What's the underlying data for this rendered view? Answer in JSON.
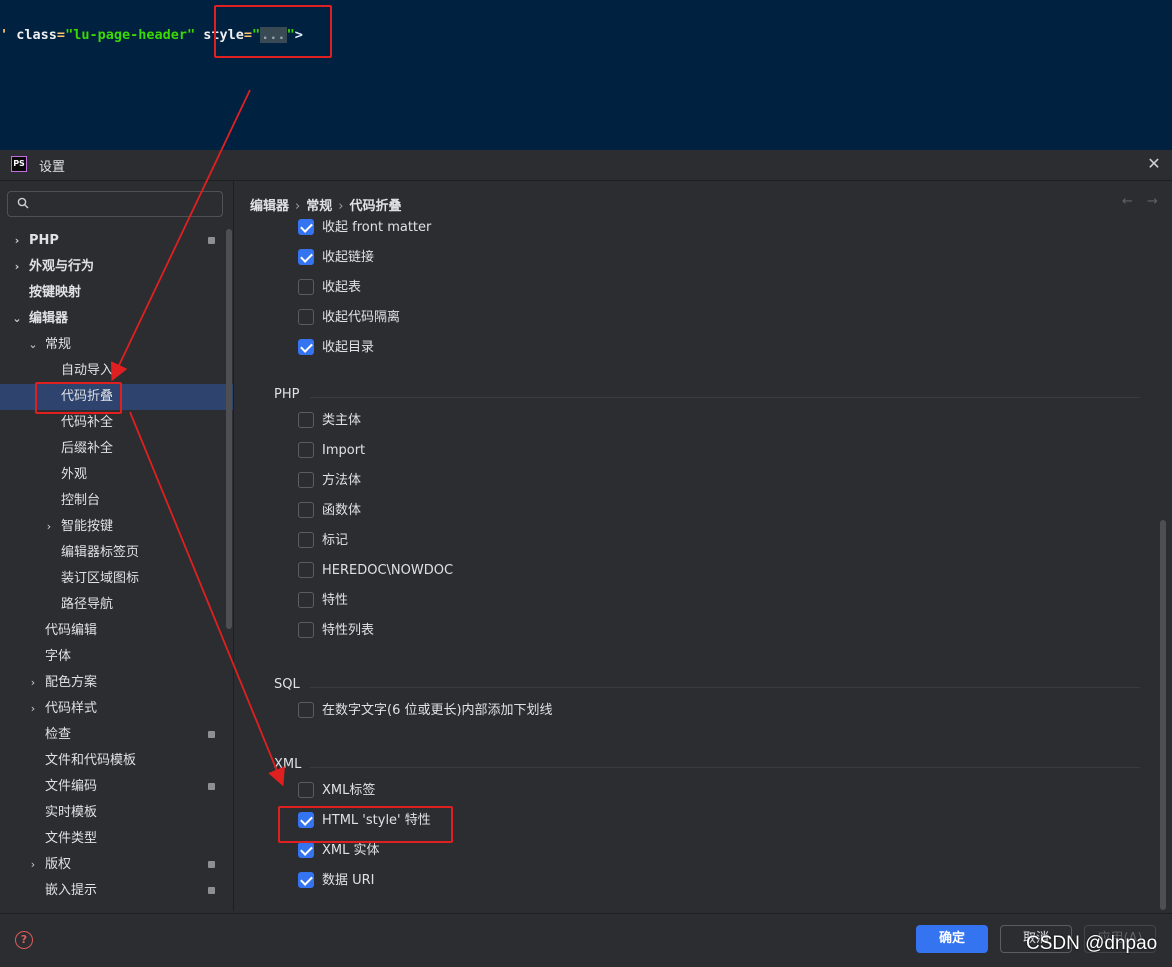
{
  "code": {
    "quote": "'",
    "attr1": " class",
    "eq1": "=",
    "val1": "\"lu-page-header\"",
    "attr2": " style",
    "eq2": "=",
    "valopen": "\"",
    "fold": "...",
    "valclose": "\"",
    "end": ">"
  },
  "dialog": {
    "logo": "PS",
    "title": "设置",
    "close": "✕"
  },
  "search": {
    "placeholder": ""
  },
  "tree": [
    {
      "label": "PHP",
      "bold": true,
      "arrow": "›",
      "badge": true
    },
    {
      "label": "外观与行为",
      "bold": true,
      "arrow": "›",
      "badge": false
    },
    {
      "label": "按键映射",
      "bold": true,
      "arrow": "",
      "badge": false
    },
    {
      "label": "编辑器",
      "bold": true,
      "arrow": "⌄",
      "badge": false
    },
    {
      "label": "常规",
      "bold": false,
      "arrow": "⌄",
      "badge": false
    },
    {
      "label": "自动导入",
      "bold": false,
      "arrow": "",
      "badge": false
    },
    {
      "label": "代码折叠",
      "bold": false,
      "arrow": "",
      "badge": false,
      "selected": true
    },
    {
      "label": "代码补全",
      "bold": false,
      "arrow": "",
      "badge": false
    },
    {
      "label": "后缀补全",
      "bold": false,
      "arrow": "",
      "badge": false
    },
    {
      "label": "外观",
      "bold": false,
      "arrow": "",
      "badge": false
    },
    {
      "label": "控制台",
      "bold": false,
      "arrow": "",
      "badge": false
    },
    {
      "label": "智能按键",
      "bold": false,
      "arrow": "›",
      "badge": false
    },
    {
      "label": "编辑器标签页",
      "bold": false,
      "arrow": "",
      "badge": false
    },
    {
      "label": "装订区域图标",
      "bold": false,
      "arrow": "",
      "badge": false
    },
    {
      "label": "路径导航",
      "bold": false,
      "arrow": "",
      "badge": false
    },
    {
      "label": "代码编辑",
      "bold": false,
      "arrow": "",
      "badge": false
    },
    {
      "label": "字体",
      "bold": false,
      "arrow": "",
      "badge": false
    },
    {
      "label": "配色方案",
      "bold": false,
      "arrow": "›",
      "badge": false
    },
    {
      "label": "代码样式",
      "bold": false,
      "arrow": "›",
      "badge": false
    },
    {
      "label": "检查",
      "bold": false,
      "arrow": "",
      "badge": true
    },
    {
      "label": "文件和代码模板",
      "bold": false,
      "arrow": "",
      "badge": false
    },
    {
      "label": "文件编码",
      "bold": false,
      "arrow": "",
      "badge": true
    },
    {
      "label": "实时模板",
      "bold": false,
      "arrow": "",
      "badge": false
    },
    {
      "label": "文件类型",
      "bold": false,
      "arrow": "",
      "badge": false
    },
    {
      "label": "版权",
      "bold": false,
      "arrow": "›",
      "badge": true
    },
    {
      "label": "嵌入提示",
      "bold": false,
      "arrow": "",
      "badge": true
    }
  ],
  "breadcrumb": [
    "编辑器",
    "常规",
    "代码折叠"
  ],
  "nav": {
    "back": "←",
    "forward": "→"
  },
  "options_top": [
    {
      "label": "收起 front matter",
      "checked": true
    },
    {
      "label": "收起链接",
      "checked": true
    },
    {
      "label": "收起表",
      "checked": false
    },
    {
      "label": "收起代码隔离",
      "checked": false
    },
    {
      "label": "收起目录",
      "checked": true
    }
  ],
  "sections": [
    {
      "title": "PHP",
      "options": [
        {
          "label": "类主体",
          "checked": false
        },
        {
          "label": "Import",
          "checked": false
        },
        {
          "label": "方法体",
          "checked": false
        },
        {
          "label": "函数体",
          "checked": false
        },
        {
          "label": "标记",
          "checked": false
        },
        {
          "label": "HEREDOC\\NOWDOC",
          "checked": false
        },
        {
          "label": "特性",
          "checked": false
        },
        {
          "label": "特性列表",
          "checked": false
        }
      ]
    },
    {
      "title": "SQL",
      "options": [
        {
          "label": "在数字文字(6 位或更长)内部添加下划线",
          "checked": false
        }
      ]
    },
    {
      "title": "XML",
      "options": [
        {
          "label": "XML标签",
          "checked": false
        },
        {
          "label": "HTML 'style' 特性",
          "checked": true
        },
        {
          "label": "XML 实体",
          "checked": true
        },
        {
          "label": "数据 URI",
          "checked": true
        }
      ]
    }
  ],
  "footer": {
    "help": "?",
    "ok": "确定",
    "cancel": "取消",
    "apply": "应用(A)"
  },
  "watermark": "CSDN @dnpao",
  "colors": {
    "accent": "#3574f0",
    "annotation": "#e02020",
    "selection": "#2e436e"
  }
}
